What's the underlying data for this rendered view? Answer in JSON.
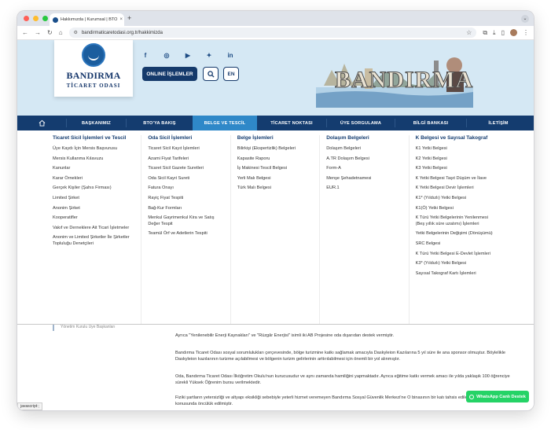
{
  "browser": {
    "tab_title": "Hakkımızda | Kurumsal | BTO",
    "tab_close": "×",
    "new_tab": "+",
    "url": "bandirmaticaretodasi.org.tr/hakkimizda"
  },
  "header": {
    "logo_line1": "BANDIRMA",
    "logo_line2": "TİCARET ODASI",
    "social_icons": [
      "facebook-icon",
      "instagram-icon",
      "youtube-icon",
      "twitter-icon",
      "linkedin-icon"
    ],
    "online_button": "ONLINE İŞLEMLER",
    "lang_button": "EN",
    "banner_text": "BANDIRMA"
  },
  "nav": {
    "items": [
      "BAŞKANIMIZ",
      "BTO'YA BAKIŞ",
      "BELGE VE TESCİL",
      "TİCARET NOKTASI",
      "ÜYE SORGULAMA",
      "BİLGİ BANKASI",
      "İLETİŞİM"
    ]
  },
  "mega": {
    "columns": [
      {
        "title": "Ticaret Sicil İşlemleri ve Tescil",
        "items": [
          "Üye Kaydı İçin Mersis Başvurusu",
          "Mersis Kullanma Kılavuzu",
          "Kanunlar",
          "Karar Örnekleri",
          "Gerçek Kişiler (Şahıs Firması)",
          "Limited Şirket",
          "Anonim Şirket",
          "Kooperatifler",
          "Vakıf ve Derneklere Ait Ticari İşletmeler",
          "Anonim ve Limited Şirketler İle Şirketler Topluluğu Denetçileri"
        ]
      },
      {
        "title": "Oda Sicil İşlemleri",
        "items": [
          "Ticaret Sicil Kayıt İşlemleri",
          "Azami Fiyat Tarifeleri",
          "Ticaret Sicil Gazete Suretleri",
          "Oda Sicil Kayıt Sureti",
          "Fatura Onayı",
          "Rayiç Fiyat Tespiti",
          "Bağ-Kur Formları",
          "Menkul Gayrimenkul Kira ve Satış Değer Tespit",
          "Teamül Örf ve Adetlerin Tespiti"
        ]
      },
      {
        "title": "Belge İşlemleri",
        "items": [
          "Bilirkişi (Ekspertizlik) Belgeleri",
          "Kapasite Raporu",
          "İş Makinesi Tescil Belgesi",
          "Yerli Malı Belgesi",
          "Türk Malı Belgesi"
        ]
      },
      {
        "title": "Dolaşım Belgeleri",
        "items": [
          "Dolaşım Belgeleri",
          "A.TR Dolaşım Belgesi",
          "Form-A",
          "Menşe Şehadetnamesi",
          "EUR.1"
        ]
      },
      {
        "title": "K Belgesi ve Sayısal Takograf",
        "items": [
          "K1 Yetki Belgesi",
          "K2 Yetki Belgesi",
          "K3 Yetki Belgesi",
          "K Yetki Belgesi Taşıt Düşüm ve İlave",
          "K Yetki Belgesi Devir İşlemleri",
          "K1* (Yıldızlı) Yetki Belgesi",
          "K1(Ö) Yetki Belgesi",
          "K Türü Yetki Belgelerinin Yenilenmesi (Beş yıllık süre uzatımı) İşlemleri",
          "Yetki Belgelerinin Değişimi (Dönüşümü)",
          "SRC Belgesi",
          "K Türü Yetki Belgesi E-Devlet İşlemleri",
          "K3* (Yıldızlı) Yetki Belgesi",
          "Sayısal Takograf Kartı İşlemleri"
        ]
      }
    ]
  },
  "content": {
    "sidebar_fragment": "Yönetim Kurulu Üye Başkanları",
    "paragraphs": [
      "Ayrıca \"Yenilenebilir Enerji Kaynakları\" ve \"Rüzgâr Enerjisi\" isimli iki AB Projesine oda dışarıdan destek vermiştir.",
      "Bandırma Ticaret Odası sosyal sorumlulukları çerçevesinde, bölge turizmine katkı sağlamak amacıyla Daskyleion Kazılarına 5 yıl süre ile ana sponsor olmuştur. Böylelikle Daskyleion kazılarının turizme açılabilmesi ve bölgenin turizm gelirlerinin arttırılabilmesi için önemli bir yol alınmıştır.",
      "Oda, Bandırma Ticaret Odası İlköğretim Okulu'nun kurucusudur ve aynı zamanda hamiliğini yapmaktadır. Ayrıca eğitime katkı vermek amacı ile yılda yaklaşık 100 öğrenciye sürekli Yüksek Öğrenim bursu verilmektedir.",
      "Fiziki şartların yetersizliği ve altyapı eksikliği sebebiyle yeterli hizmet veremeyen Bandırma Sosyal Güvenlik Merkezi'ne O binasının bir katı tahsis edilerek bölgeye hizmet konusunda öncülük edilmiştir."
    ],
    "status_text": "javascript:;",
    "whatsapp_label": "WhatsApp Canlı Destek"
  }
}
